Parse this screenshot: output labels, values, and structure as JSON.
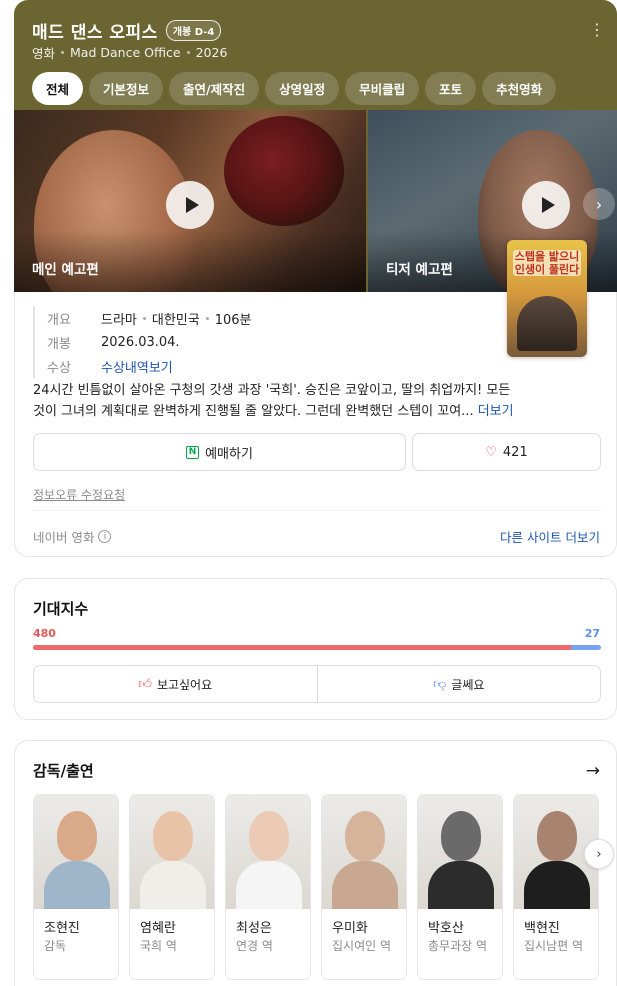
{
  "header": {
    "title": "매드 댄스 오피스",
    "badge": "개봉 D-4",
    "meta": [
      "영화",
      "Mad Dance Office",
      "2026"
    ],
    "more_icon": "kebab-icon"
  },
  "tabs": [
    {
      "label": "전체",
      "active": true
    },
    {
      "label": "기본정보",
      "active": false
    },
    {
      "label": "출연/제작진",
      "active": false
    },
    {
      "label": "상영일정",
      "active": false
    },
    {
      "label": "무비클립",
      "active": false
    },
    {
      "label": "포토",
      "active": false
    },
    {
      "label": "추천영화",
      "active": false
    }
  ],
  "videos": [
    {
      "label": "메인 예고편",
      "icon": "play-icon"
    },
    {
      "label": "티저 예고편",
      "icon": "play-icon"
    }
  ],
  "poster": {
    "text": "스텝을 밟으니 인생이 풀린다"
  },
  "facts": {
    "overview_key": "개요",
    "overview_vals": [
      "드라마",
      "대한민국",
      "106분"
    ],
    "release_key": "개봉",
    "release_val": "2026.03.04.",
    "award_key": "수상",
    "award_link": "수상내역보기"
  },
  "synopsis": {
    "line1": "24시간 빈틈없이 살아온 구청의 갓생 과장 '국희'. 승진은 코앞이고, 딸의 취업까지! 모든",
    "line2": "것이 그녀의 계획대로 완벽하게 진행될 줄 알았다. 그런데 완벽했던 스텝이 꼬여...",
    "more": "더보기"
  },
  "actions": {
    "book_label": "예매하기",
    "book_icon": "naver-n-icon",
    "like_count": "421",
    "like_icon": "heart-icon"
  },
  "footer": {
    "report": "정보오류 수정요청",
    "source": "네이버 영화",
    "other_sites": "다른 사이트 더보기"
  },
  "expectation": {
    "title": "기대지수",
    "want": 480,
    "meh": 27,
    "want_label": "보고싶어요",
    "meh_label": "글쎄요",
    "colors": {
      "want": "#ec6a6a",
      "meh": "#79a3f2"
    }
  },
  "cast": {
    "title": "감독/출연",
    "people": [
      {
        "name": "조현진",
        "role": "감독",
        "skin": "#d9a98a",
        "cloth": "#9fb5c9"
      },
      {
        "name": "염혜란",
        "role": "국희 역",
        "skin": "#e8c3a8",
        "cloth": "#f1ede8"
      },
      {
        "name": "최성은",
        "role": "연경 역",
        "skin": "#ebcbb5",
        "cloth": "#f5f5f5"
      },
      {
        "name": "우미화",
        "role": "집시여인 역",
        "skin": "#d6b49c",
        "cloth": "#c8a890"
      },
      {
        "name": "박호산",
        "role": "총무과장 역",
        "skin": "#6a6a6a",
        "cloth": "#2c2c2c"
      },
      {
        "name": "백현진",
        "role": "집시남편 역",
        "skin": "#a88470",
        "cloth": "#1e1e1e"
      }
    ]
  }
}
